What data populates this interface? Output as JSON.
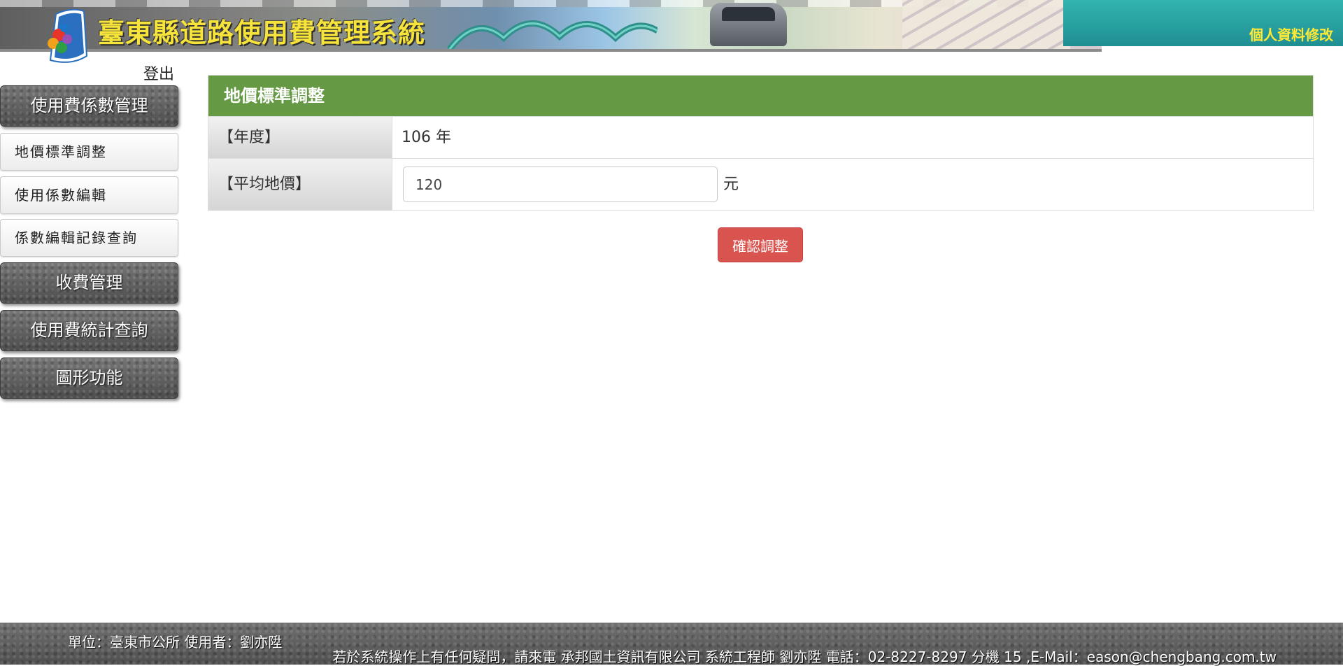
{
  "header": {
    "system_title": "臺東縣道路使用費管理系統",
    "profile_link": "個人資料修改"
  },
  "sidebar": {
    "logout": "登出",
    "menu": [
      {
        "label": "使用費係數管理",
        "type": "header"
      },
      {
        "label": "地價標準調整",
        "type": "item"
      },
      {
        "label": "使用係數編輯",
        "type": "item"
      },
      {
        "label": "係數編輯記錄查詢",
        "type": "item"
      },
      {
        "label": "收費管理",
        "type": "header"
      },
      {
        "label": "使用費統計查詢",
        "type": "header"
      },
      {
        "label": "圖形功能",
        "type": "header"
      }
    ]
  },
  "panel": {
    "title": "地價標準調整",
    "year_label": "【年度】",
    "year_value": "106 年",
    "price_label": "【平均地價】",
    "price_value": "120",
    "price_unit": "元",
    "confirm_label": "確認調整"
  },
  "footer": {
    "unit_user": "單位：臺東市公所 使用者：劉亦陞",
    "contact": "若於系統操作上有任何疑問，請來電 承邦國土資訊有限公司 系統工程師 劉亦陞 電話：02-8227-8297 分機 15 ,E-Mail：eason@chengbang.com.tw"
  },
  "colors": {
    "panel_heading": "#669944",
    "confirm_button": "#d9534f",
    "profile_link": "#ffe934",
    "title_yellow": "#f6e33b"
  }
}
